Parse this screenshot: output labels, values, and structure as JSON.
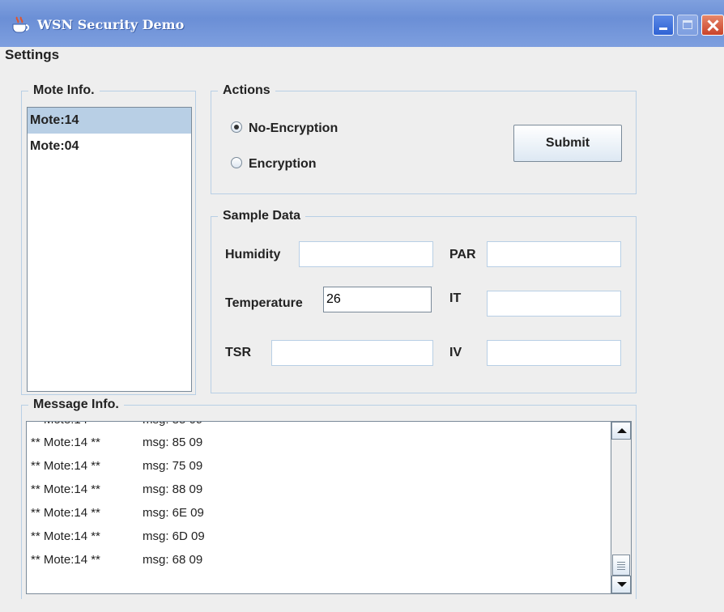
{
  "window": {
    "title": "WSN Security Demo",
    "app_icon": "java-cup-icon"
  },
  "menubar": {
    "settings": "Settings"
  },
  "mote_info": {
    "legend": "Mote Info.",
    "items": [
      "Mote:14",
      "Mote:04"
    ],
    "selected_index": 0
  },
  "actions": {
    "legend": "Actions",
    "radios": [
      {
        "label": "No-Encryption",
        "checked": true
      },
      {
        "label": "Encryption",
        "checked": false
      }
    ],
    "submit": "Submit"
  },
  "sample_data": {
    "legend": "Sample Data",
    "humidity": {
      "label": "Humidity",
      "value": ""
    },
    "par": {
      "label": "PAR",
      "value": ""
    },
    "temperature": {
      "label": "Temperature",
      "value": "26"
    },
    "it": {
      "label": "IT",
      "value": ""
    },
    "tsr": {
      "label": "TSR",
      "value": ""
    },
    "iv": {
      "label": "IV",
      "value": ""
    }
  },
  "message_info": {
    "legend": "Message Info.",
    "rows": [
      {
        "mote": "** Mote:14 **",
        "msg": "msg: 85 09"
      },
      {
        "mote": "** Mote:14 **",
        "msg": "msg: 75 09"
      },
      {
        "mote": "** Mote:14 **",
        "msg": "msg: 88 09"
      },
      {
        "mote": "** Mote:14 **",
        "msg": "msg: 6E 09"
      },
      {
        "mote": "** Mote:14 **",
        "msg": "msg: 6D 09"
      },
      {
        "mote": "** Mote:14 **",
        "msg": "msg: 68 09"
      }
    ]
  },
  "colors": {
    "titlebar": "#6b8fd6",
    "selection": "#b8cfe5",
    "group_border": "#b8cfe5"
  }
}
